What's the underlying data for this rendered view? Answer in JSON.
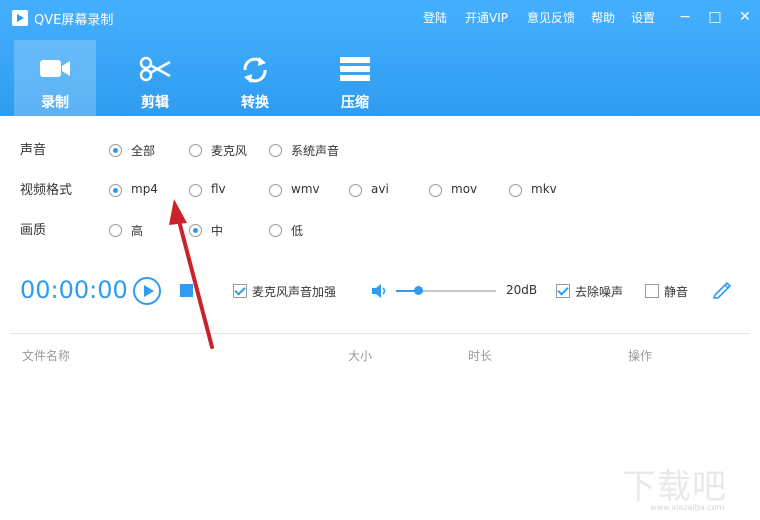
{
  "app": {
    "title": "QVE屏幕录制"
  },
  "topnav": {
    "login": "登陆",
    "vip": "开通VIP",
    "feedback": "意见反馈",
    "help": "帮助",
    "settings": "设置"
  },
  "window": {
    "minimize": "−",
    "maximize": "□",
    "close": "✕"
  },
  "tabs": [
    {
      "label": "录制",
      "icon": "camera-icon",
      "active": true
    },
    {
      "label": "剪辑",
      "icon": "scissors-icon"
    },
    {
      "label": "转换",
      "icon": "refresh-icon"
    },
    {
      "label": "压缩",
      "icon": "compress-icon"
    }
  ],
  "settings": {
    "sound": {
      "label": "声音",
      "options": [
        "全部",
        "麦克风",
        "系统声音"
      ],
      "selected": "全部"
    },
    "format": {
      "label": "视频格式",
      "options": [
        "mp4",
        "flv",
        "wmv",
        "avi",
        "mov",
        "mkv"
      ],
      "selected": "mp4"
    },
    "quality": {
      "label": "画质",
      "options": [
        "高",
        "中",
        "低"
      ],
      "selected": "中"
    }
  },
  "controls": {
    "timer": "00:00:00",
    "mic_boost": {
      "label": "麦克风声音加强",
      "checked": true
    },
    "volume": {
      "value": "20dB",
      "level": 0.22
    },
    "denoise": {
      "label": "去除噪声",
      "checked": true
    },
    "mute": {
      "label": "静音",
      "checked": false
    }
  },
  "table": {
    "columns": [
      "文件名称",
      "大小",
      "时长",
      "操作"
    ]
  },
  "watermark": {
    "text": "下载吧",
    "url": "www.xiazaiba.com"
  },
  "colors": {
    "accent": "#2f9cf0",
    "arrow": "#c8222a"
  }
}
